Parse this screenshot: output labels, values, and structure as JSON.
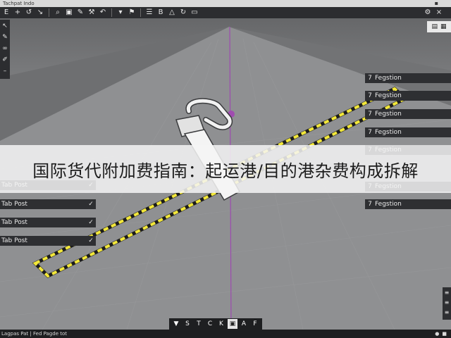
{
  "window": {
    "title": "Tachpat Indo"
  },
  "top_toolbar": {
    "buttons": [
      {
        "icon": "select-icon",
        "glyph": "E"
      },
      {
        "icon": "move-icon",
        "glyph": "+"
      },
      {
        "icon": "rotate-icon",
        "glyph": "↺"
      },
      {
        "icon": "scale-icon",
        "glyph": "↘"
      },
      {
        "icon": "search-icon",
        "glyph": "⌕"
      },
      {
        "icon": "image-icon",
        "glyph": "▣"
      },
      {
        "icon": "pencil-icon",
        "glyph": "✎"
      },
      {
        "icon": "brush-icon",
        "glyph": "⚒"
      },
      {
        "icon": "undo-icon",
        "glyph": "↶"
      },
      {
        "icon": "dropdown-icon",
        "glyph": "▾"
      },
      {
        "icon": "flag-icon",
        "glyph": "⚑"
      },
      {
        "icon": "grid-icon",
        "glyph": "☰"
      },
      {
        "icon": "text-icon",
        "glyph": "B"
      },
      {
        "icon": "measure-icon",
        "glyph": "△"
      },
      {
        "icon": "refresh-icon",
        "glyph": "↻"
      },
      {
        "icon": "comment-icon",
        "glyph": "▭"
      }
    ],
    "right_buttons": [
      {
        "icon": "settings-icon",
        "glyph": "⚙"
      },
      {
        "icon": "close-icon",
        "glyph": "×"
      }
    ]
  },
  "left_toolbar": {
    "buttons": [
      {
        "icon": "arrow-icon",
        "glyph": "↖"
      },
      {
        "icon": "pen-icon",
        "glyph": "✎"
      },
      {
        "icon": "link-icon",
        "glyph": "∞"
      },
      {
        "icon": "brush-icon",
        "glyph": "✐"
      },
      {
        "icon": "minus-icon",
        "glyph": "–"
      }
    ]
  },
  "top_right_panel": {
    "buttons": [
      {
        "icon": "layers-icon",
        "glyph": "▤"
      },
      {
        "icon": "layout-icon",
        "glyph": "▦"
      }
    ]
  },
  "right_panel": {
    "items": [
      {
        "num": "7",
        "label": "Fegstion"
      },
      {
        "num": "7",
        "label": "Fegstion"
      },
      {
        "num": "7",
        "label": "Fegstion"
      },
      {
        "num": "7",
        "label": "Fegstion"
      },
      {
        "num": "7",
        "label": "Fegstion"
      },
      {
        "num": "7",
        "label": "Fegstion"
      },
      {
        "num": "7",
        "label": "Fegstion"
      }
    ]
  },
  "left_tabs": {
    "items": [
      {
        "label": "Tab Post",
        "check": "✓"
      },
      {
        "label": "Tab Post",
        "check": "✓"
      },
      {
        "label": "Tab Post",
        "check": "✓"
      },
      {
        "label": "Tab Post",
        "check": "✓"
      }
    ]
  },
  "caption": "国际货代附加费指南：起运港/目的港杂费构成拆解",
  "bottom_toolbar": {
    "buttons": [
      {
        "icon": "pointer-icon",
        "glyph": "▼",
        "active": false
      },
      {
        "icon": "s-icon",
        "glyph": "S",
        "active": false
      },
      {
        "icon": "t-icon",
        "glyph": "T",
        "active": false
      },
      {
        "icon": "c-icon",
        "glyph": "C",
        "active": false
      },
      {
        "icon": "k-icon",
        "glyph": "K",
        "active": false
      },
      {
        "icon": "image-icon",
        "glyph": "▣",
        "active": true
      },
      {
        "icon": "a-icon",
        "glyph": "A",
        "active": false
      },
      {
        "icon": "f-icon",
        "glyph": "F",
        "active": false
      }
    ]
  },
  "status_bar": {
    "left": "Lagpas Pat  |  Fed Pagde tot",
    "right_icons": [
      {
        "icon": "globe-icon",
        "glyph": "●"
      },
      {
        "icon": "status-icon",
        "glyph": "■"
      }
    ]
  },
  "right_edge": {
    "buttons": [
      {
        "icon": "expand-icon",
        "glyph": "≡"
      },
      {
        "icon": "collapse-icon",
        "glyph": "≡"
      },
      {
        "icon": "more-icon",
        "glyph": "≡"
      }
    ]
  },
  "colors": {
    "accent_yellow": "#f3e83a",
    "panel_dark": "#2e2f32",
    "viewport_grey": "#8b8c8e",
    "axis_purple": "#9d4bb0"
  }
}
